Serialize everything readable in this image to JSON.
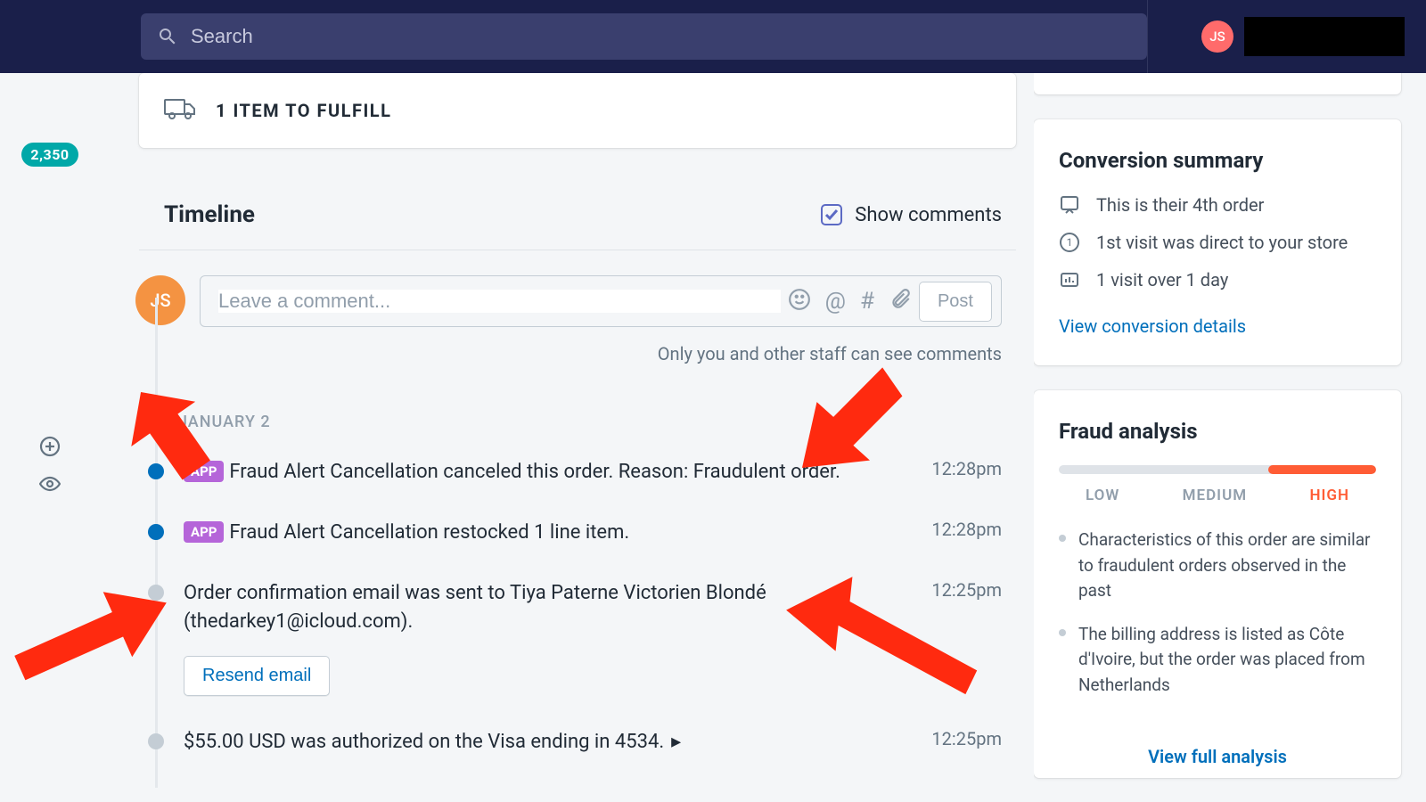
{
  "topbar": {
    "search_placeholder": "Search",
    "avatar_initials": "JS"
  },
  "leftrail": {
    "badge": "2,350"
  },
  "fulfill": {
    "label": "1 ITEM TO FULFILL"
  },
  "timeline": {
    "title": "Timeline",
    "show_comments_label": "Show comments",
    "comment": {
      "avatar_initials": "JS",
      "placeholder": "Leave a comment...",
      "post_label": "Post",
      "note": "Only you and other staff can see comments"
    },
    "date_label": "JANUARY 2",
    "events": [
      {
        "app": true,
        "text": "Fraud Alert Cancellation canceled this order. Reason: Fraudulent order.",
        "time": "12:28pm",
        "dot": "blue"
      },
      {
        "app": true,
        "text": "Fraud Alert Cancellation restocked 1 line item.",
        "time": "12:28pm",
        "dot": "blue"
      },
      {
        "app": false,
        "text": "Order confirmation email was sent to Tiya Paterne Victorien Blondé (thedarkey1@icloud.com).",
        "time": "12:25pm",
        "dot": "grey",
        "resend_label": "Resend email"
      },
      {
        "app": false,
        "text": "$55.00 USD was authorized on the Visa ending in 4534.",
        "time": "12:25pm",
        "dot": "grey",
        "caret": true
      }
    ],
    "app_tag": "APP"
  },
  "conversion": {
    "title": "Conversion summary",
    "rows": [
      "This is their 4th order",
      "1st visit was direct to your store",
      "1 visit over 1 day"
    ],
    "link": "View conversion details"
  },
  "fraud": {
    "title": "Fraud analysis",
    "labels": {
      "low": "LOW",
      "medium": "MEDIUM",
      "high": "HIGH"
    },
    "items": [
      "Characteristics of this order are similar to fraudulent orders observed in the past",
      "The billing address is listed as Côte d'Ivoire, but the order was placed from Netherlands"
    ],
    "link": "View full analysis"
  }
}
